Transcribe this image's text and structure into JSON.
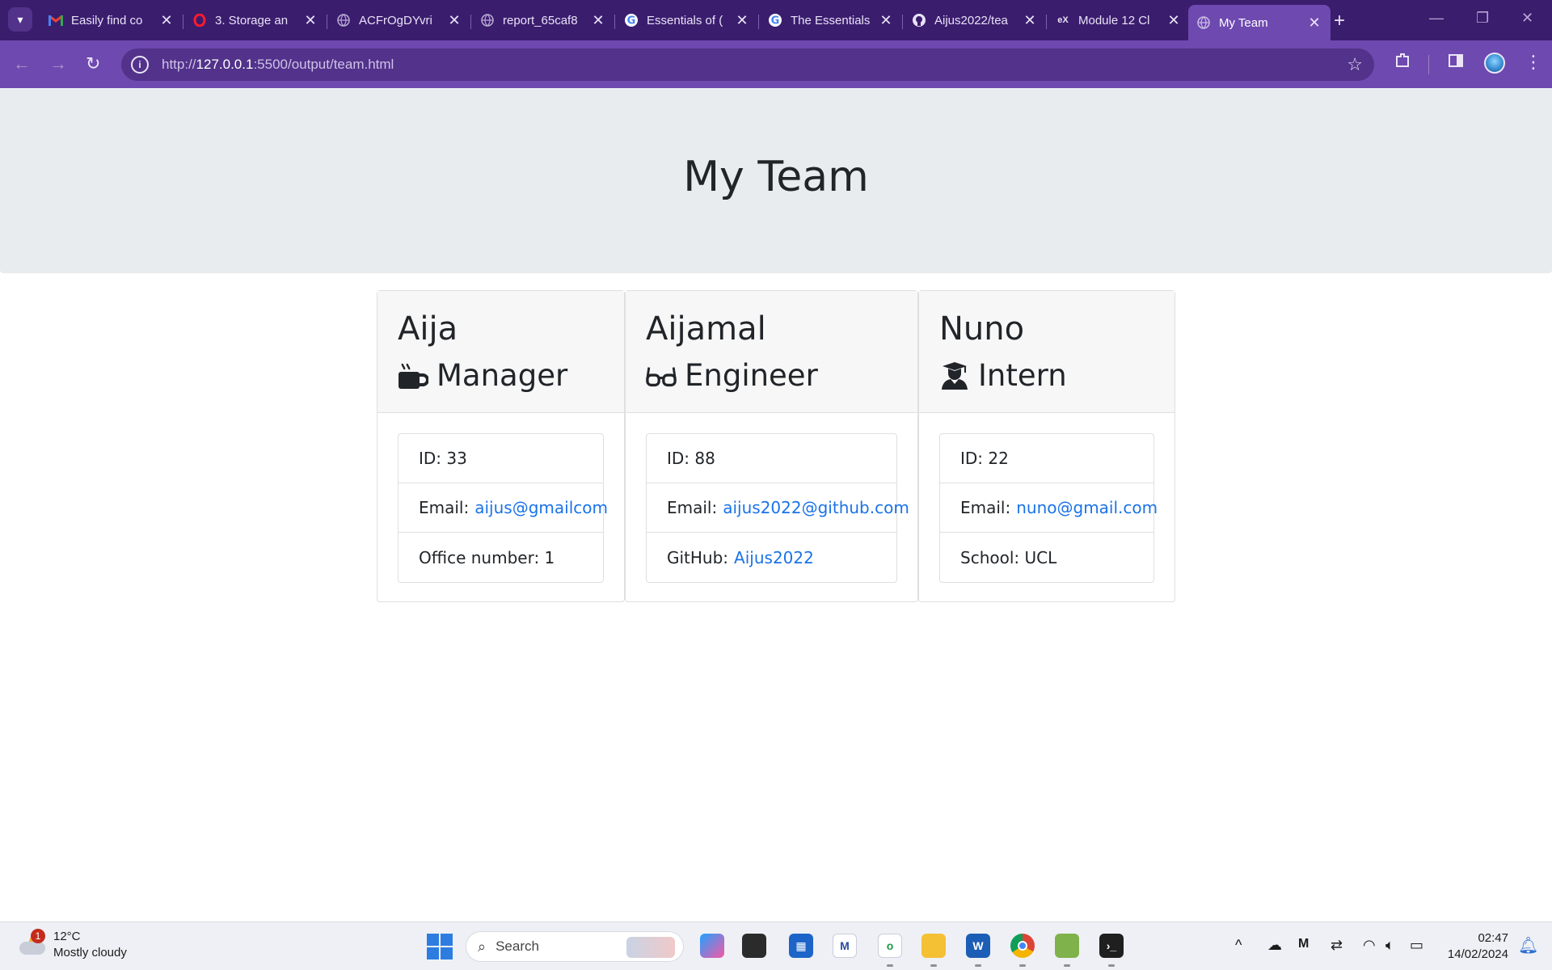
{
  "browser": {
    "tabs": [
      {
        "title": "Easily find co",
        "favicon": "gmail-icon"
      },
      {
        "title": "3. Storage an",
        "favicon": "opera-icon"
      },
      {
        "title": "ACFrOgDYvri",
        "favicon": "globe-icon"
      },
      {
        "title": "report_65caf8",
        "favicon": "globe-icon"
      },
      {
        "title": "Essentials of (",
        "favicon": "google-icon"
      },
      {
        "title": "The Essentials",
        "favicon": "google-icon"
      },
      {
        "title": "Aijus2022/tea",
        "favicon": "github-icon"
      },
      {
        "title": "Module 12 Cl",
        "favicon": "edx-icon"
      },
      {
        "title": "My Team",
        "favicon": "globe-icon",
        "active": true
      }
    ],
    "url_prefix": "http://",
    "url_host": "127.0.0.1",
    "url_rest": ":5500/output/team.html"
  },
  "page": {
    "heading": "My Team"
  },
  "team": [
    {
      "name": "Aija",
      "role": "Manager",
      "role_icon": "mug-icon",
      "id_label": "ID:",
      "id": "33",
      "email_label": "Email:",
      "email": "aijus@gmailcom",
      "extra_label": "Office number:",
      "extra_value": "1",
      "extra_is_link": false
    },
    {
      "name": "Aijamal",
      "role": "Engineer",
      "role_icon": "glasses-icon",
      "id_label": "ID:",
      "id": "88",
      "email_label": "Email:",
      "email": "aijus2022@github.com",
      "extra_label": "GitHub:",
      "extra_value": "Aijus2022",
      "extra_is_link": true
    },
    {
      "name": "Nuno",
      "role": "Intern",
      "role_icon": "graduate-icon",
      "id_label": "ID:",
      "id": "22",
      "email_label": "Email:",
      "email": "nuno@gmail.com",
      "extra_label": "School:",
      "extra_value": "UCL",
      "extra_is_link": false
    }
  ],
  "taskbar": {
    "weather_temp": "12°C",
    "weather_desc": "Mostly cloudy",
    "weather_badge": "1",
    "search_placeholder": "Search",
    "time": "02:47",
    "date": "14/02/2024"
  },
  "colors": {
    "tabbar": "#3b1d6e",
    "toolbar": "#6e49b0",
    "link": "#1a73e8",
    "jumbotron": "#e9ecef"
  }
}
